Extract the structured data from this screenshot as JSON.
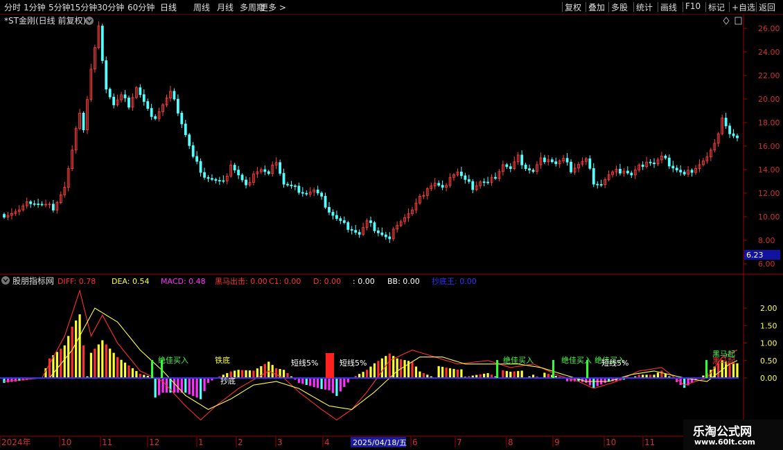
{
  "toolbar": {
    "periods": [
      "分时",
      "1分钟",
      "5分钟",
      "15分钟",
      "30分钟",
      "60分钟",
      "日线",
      "周线",
      "月线",
      "多周期",
      "更多 >"
    ],
    "active_period": "日线",
    "actions": [
      "复权",
      "叠加",
      "多股",
      "统计",
      "画线",
      "F10",
      "标记",
      "+自选",
      "返回"
    ]
  },
  "main_panel": {
    "title": "*ST金刚(日线 前复权)",
    "current_price_label": "6.23"
  },
  "indicator_panel": {
    "name": "股朋指标网",
    "legend": [
      {
        "label": "DIFF: 0.78",
        "color": "#ff3030"
      },
      {
        "label": "DEA: 0.54",
        "color": "#ffff40"
      },
      {
        "label": "MACD: 0.48",
        "color": "#ff30ff"
      },
      {
        "label": "黑马出击: 0.00",
        "color": "#ff3030"
      },
      {
        "label": "C1: 0.00",
        "color": "#ff3030"
      },
      {
        "label": "D: 0.00",
        "color": "#ff3030"
      },
      {
        "label": ": 0.00",
        "color": "#ffffff"
      },
      {
        "label": "BB: 0.00",
        "color": "#ffffff"
      },
      {
        "label": "抄底王: 0.00",
        "color": "#3030ff"
      }
    ]
  },
  "x_axis": {
    "labels": [
      "2024年",
      "10",
      "11",
      "12",
      "1",
      "2",
      "3",
      "4",
      "6",
      "7",
      "8",
      "9",
      "10",
      "11"
    ],
    "cursor_label": "2025/04/18/五"
  },
  "signals": [
    "绝佳买入",
    "绝佳买入",
    "绝佳买入",
    "绝佳买入",
    "短线5%",
    "短线5%",
    "短线5%",
    "铁底",
    "黑马起",
    "黑马起",
    "抄底"
  ],
  "watermark": {
    "line1": "乐淘公式网",
    "line2": "www.60lt.com"
  },
  "chart_data": [
    {
      "type": "candlestick",
      "title": "*ST金刚(日线 前复权)",
      "ylim": [
        5.5,
        27
      ],
      "yticks": [
        6.0,
        8.0,
        10.0,
        12.0,
        14.0,
        16.0,
        18.0,
        20.0,
        22.0,
        24.0,
        26.0
      ],
      "close_path": [
        [
          0,
          10.2
        ],
        [
          4,
          10.5
        ],
        [
          7,
          11.3
        ],
        [
          10,
          11.0
        ],
        [
          13,
          10.8
        ],
        [
          16,
          12.5
        ],
        [
          18,
          15.5
        ],
        [
          20,
          19.0
        ],
        [
          21,
          17.5
        ],
        [
          23,
          22.5
        ],
        [
          25,
          26.0
        ],
        [
          27,
          21.0
        ],
        [
          29,
          19.5
        ],
        [
          31,
          20.2
        ],
        [
          33,
          19.5
        ],
        [
          35,
          21.0
        ],
        [
          38,
          19.0
        ],
        [
          40,
          18.5
        ],
        [
          42,
          19.5
        ],
        [
          44,
          20.5
        ],
        [
          46,
          19.0
        ],
        [
          48,
          17.0
        ],
        [
          50,
          15.0
        ],
        [
          53,
          13.5
        ],
        [
          56,
          13.0
        ],
        [
          58,
          12.8
        ],
        [
          60,
          14.5
        ],
        [
          62,
          13.5
        ],
        [
          64,
          12.5
        ],
        [
          66,
          13.8
        ],
        [
          68,
          14.0
        ],
        [
          70,
          13.5
        ],
        [
          72,
          14.8
        ],
        [
          74,
          12.8
        ],
        [
          76,
          12.5
        ],
        [
          78,
          12.3
        ],
        [
          80,
          12.0
        ],
        [
          82,
          12.2
        ],
        [
          84,
          11.5
        ],
        [
          86,
          10.5
        ],
        [
          88,
          9.8
        ],
        [
          90,
          9.3
        ],
        [
          92,
          9.0
        ],
        [
          94,
          8.5
        ],
        [
          96,
          9.5
        ],
        [
          98,
          9.0
        ],
        [
          100,
          8.5
        ],
        [
          102,
          8.0
        ],
        [
          104,
          9.5
        ],
        [
          106,
          10.0
        ],
        [
          108,
          10.5
        ],
        [
          110,
          11.5
        ],
        [
          112,
          12.5
        ],
        [
          114,
          12.8
        ],
        [
          116,
          12.3
        ],
        [
          118,
          13.5
        ],
        [
          120,
          13.8
        ],
        [
          122,
          13.0
        ],
        [
          124,
          12.5
        ],
        [
          126,
          13.0
        ],
        [
          128,
          12.8
        ],
        [
          130,
          13.5
        ],
        [
          132,
          14.5
        ],
        [
          134,
          14.0
        ],
        [
          136,
          15.0
        ],
        [
          138,
          14.2
        ],
        [
          140,
          13.8
        ],
        [
          142,
          14.8
        ],
        [
          144,
          15.0
        ],
        [
          146,
          14.5
        ],
        [
          148,
          14.8
        ],
        [
          150,
          14.0
        ],
        [
          152,
          14.5
        ],
        [
          154,
          14.8
        ],
        [
          156,
          13.0
        ],
        [
          158,
          12.8
        ],
        [
          160,
          13.5
        ],
        [
          162,
          13.8
        ],
        [
          164,
          14.0
        ],
        [
          166,
          13.5
        ],
        [
          168,
          14.2
        ],
        [
          170,
          14.8
        ],
        [
          172,
          14.5
        ],
        [
          174,
          15.0
        ],
        [
          176,
          14.5
        ],
        [
          178,
          14.0
        ],
        [
          180,
          13.5
        ],
        [
          182,
          14.0
        ],
        [
          184,
          14.5
        ],
        [
          186,
          15.0
        ],
        [
          188,
          16.0
        ],
        [
          190,
          18.5
        ],
        [
          192,
          17.0
        ],
        [
          194,
          16.5
        ]
      ]
    },
    {
      "type": "bar",
      "title": "股朋指标网",
      "ylim": [
        -2.35,
        2.9
      ],
      "yticks": [
        0.0,
        0.5,
        1.0,
        1.5,
        2.0
      ],
      "series": [
        {
          "name": "DIFF",
          "color": "#ff3030",
          "values_path": [
            [
              0,
              -0.1
            ],
            [
              10,
              0.0
            ],
            [
              16,
              1.2
            ],
            [
              20,
              2.5
            ],
            [
              23,
              1.2
            ],
            [
              26,
              1.8
            ],
            [
              30,
              1.0
            ],
            [
              36,
              0.2
            ],
            [
              42,
              -0.1
            ],
            [
              48,
              -0.8
            ],
            [
              52,
              -1.2
            ],
            [
              56,
              -0.8
            ],
            [
              62,
              -0.3
            ],
            [
              70,
              0.2
            ],
            [
              74,
              0.0
            ],
            [
              78,
              -0.4
            ],
            [
              84,
              -0.9
            ],
            [
              88,
              -1.2
            ],
            [
              92,
              -0.9
            ],
            [
              96,
              -0.4
            ],
            [
              102,
              0.5
            ],
            [
              108,
              0.8
            ],
            [
              114,
              0.6
            ],
            [
              120,
              0.4
            ],
            [
              128,
              0.5
            ],
            [
              134,
              0.3
            ],
            [
              140,
              0.4
            ],
            [
              146,
              0.1
            ],
            [
              152,
              -0.1
            ],
            [
              156,
              -0.3
            ],
            [
              162,
              -0.1
            ],
            [
              168,
              0.2
            ],
            [
              174,
              0.3
            ],
            [
              180,
              -0.2
            ],
            [
              186,
              0.0
            ],
            [
              190,
              0.6
            ],
            [
              194,
              0.8
            ]
          ]
        },
        {
          "name": "DEA",
          "color": "#ffff40",
          "values_path": [
            [
              0,
              0.0
            ],
            [
              12,
              0.0
            ],
            [
              18,
              0.8
            ],
            [
              24,
              2.0
            ],
            [
              30,
              1.6
            ],
            [
              36,
              0.8
            ],
            [
              42,
              0.2
            ],
            [
              48,
              -0.5
            ],
            [
              54,
              -0.9
            ],
            [
              60,
              -0.6
            ],
            [
              66,
              -0.2
            ],
            [
              72,
              -0.1
            ],
            [
              78,
              -0.3
            ],
            [
              86,
              -0.8
            ],
            [
              92,
              -0.9
            ],
            [
              98,
              -0.4
            ],
            [
              104,
              0.2
            ],
            [
              110,
              0.6
            ],
            [
              116,
              0.6
            ],
            [
              122,
              0.4
            ],
            [
              130,
              0.4
            ],
            [
              136,
              0.4
            ],
            [
              142,
              0.3
            ],
            [
              148,
              0.1
            ],
            [
              154,
              -0.1
            ],
            [
              160,
              -0.1
            ],
            [
              166,
              0.1
            ],
            [
              172,
              0.2
            ],
            [
              180,
              0.0
            ],
            [
              186,
              -0.1
            ],
            [
              192,
              0.4
            ],
            [
              194,
              0.5
            ]
          ]
        }
      ]
    }
  ]
}
